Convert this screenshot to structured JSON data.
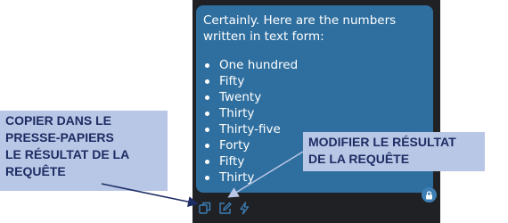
{
  "chat": {
    "intro_line1": "Certainly. Here are the numbers",
    "intro_line2": "written in text form:",
    "items": [
      "One hundred",
      "Fifty",
      "Twenty",
      "Thirty",
      "Thirty-five",
      "Forty",
      "Fifty",
      "Thirty"
    ]
  },
  "toolbar": {
    "icons": [
      "copy-icon",
      "edit-icon",
      "bolt-icon"
    ]
  },
  "annotations": {
    "copy": "COPIER DANS LE\nPRESSE-PAPIERS\nLE RÉSULTAT DE LA\nREQUÊTE",
    "edit": "MODIFIER LE RÉSULTAT\nDE LA REQUÊTE"
  },
  "colors": {
    "bubble": "#2f6f9f",
    "panel": "#202124",
    "callout": "#b9c7e6",
    "callout_text": "#1d2c63"
  }
}
